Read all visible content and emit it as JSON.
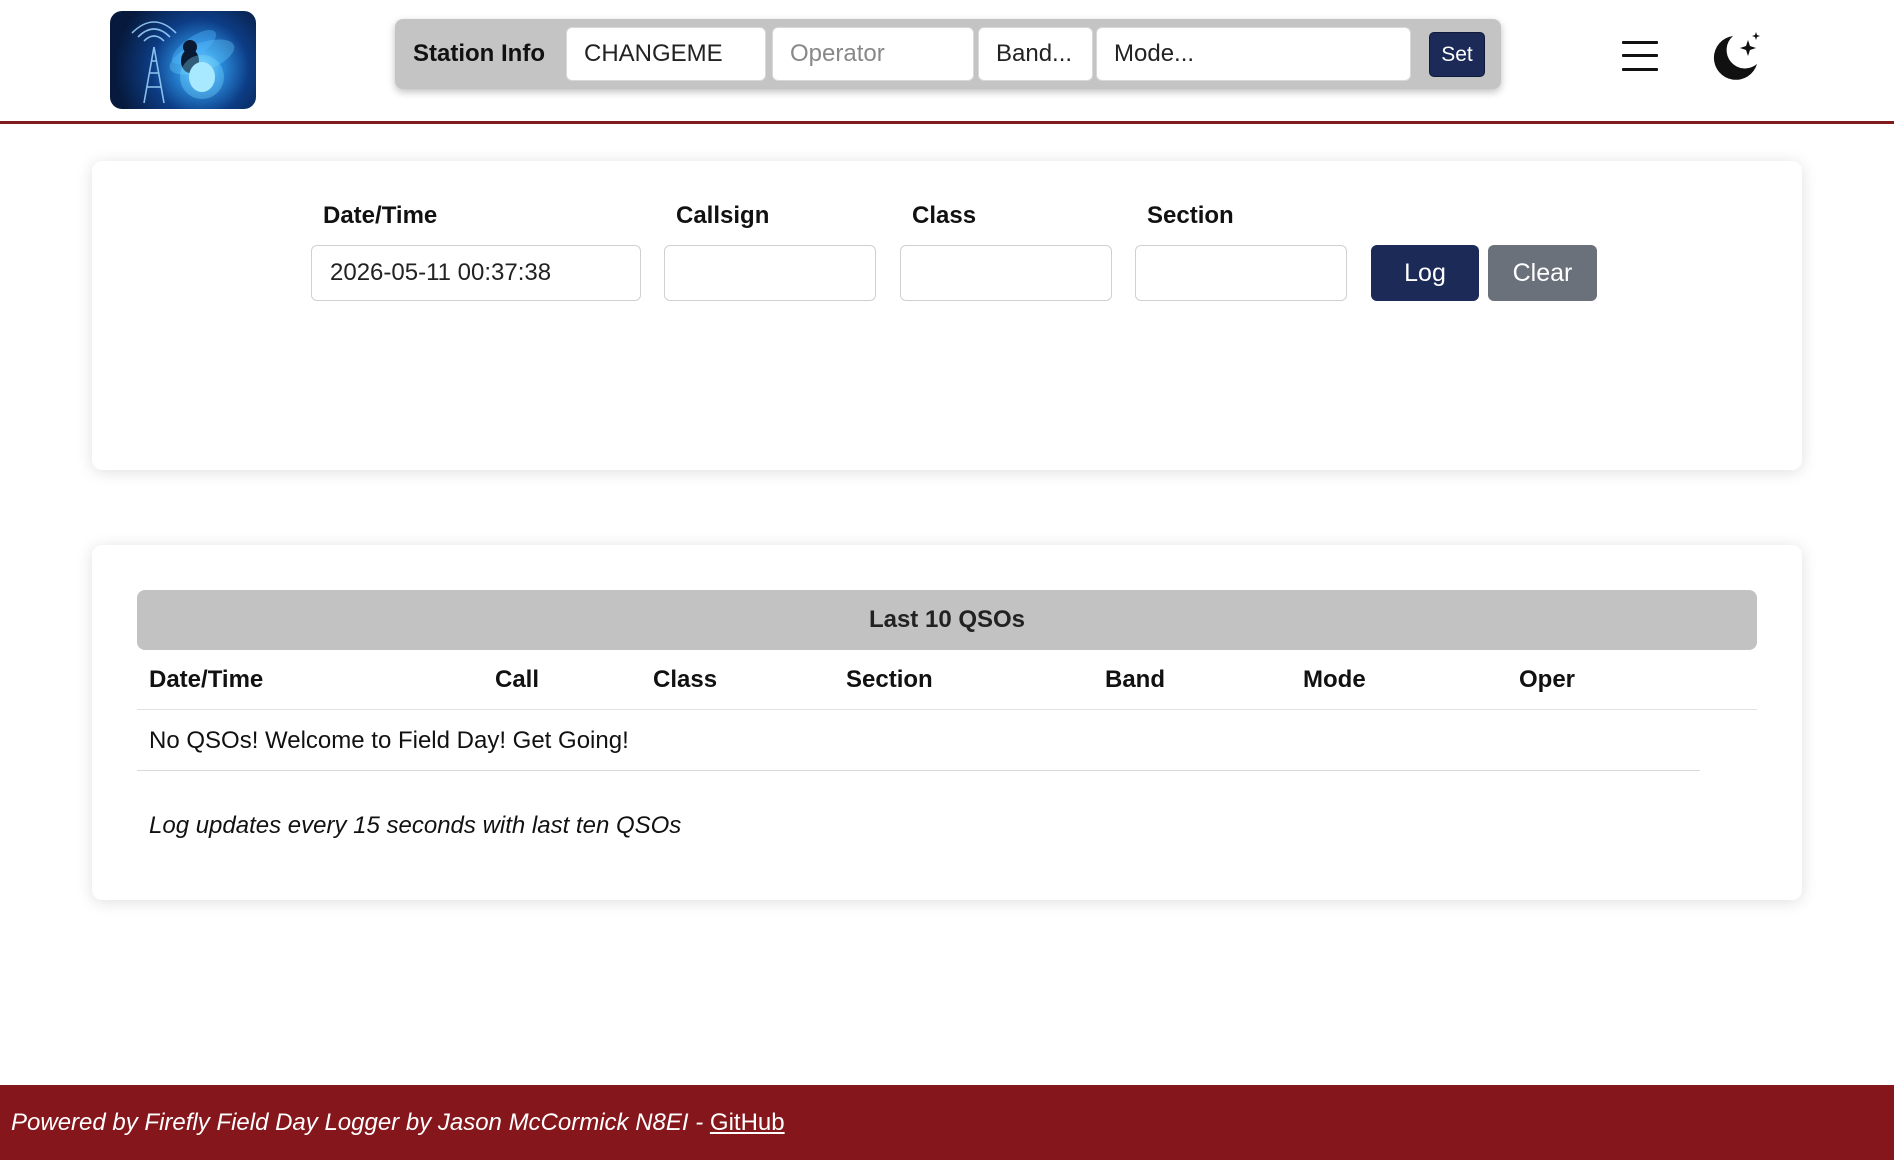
{
  "header": {
    "station_label": "Station Info",
    "callsign_value": "CHANGEME",
    "operator_placeholder": "Operator",
    "band_selected": "Band...",
    "mode_selected": "Mode...",
    "set_label": "Set",
    "menu_icon": "hamburger-menu-icon",
    "theme_icon": "moon-stars-icon"
  },
  "form": {
    "datetime_label": "Date/Time",
    "datetime_value": "2026-05-11 00:37:38",
    "callsign_label": "Callsign",
    "callsign_value": "",
    "class_label": "Class",
    "class_value": "",
    "section_label": "Section",
    "section_value": "",
    "log_label": "Log",
    "clear_label": "Clear"
  },
  "qsos": {
    "title": "Last 10 QSOs",
    "columns": [
      "Date/Time",
      "Call",
      "Class",
      "Section",
      "Band",
      "Mode",
      "Oper"
    ],
    "empty_message": "No QSOs! Welcome to Field Day! Get Going!",
    "note": "Log updates every 15 seconds with last ten QSOs"
  },
  "footer": {
    "text": "Powered by Firefly Field Day Logger by Jason McCormick N8EI - ",
    "link_label": "GitHub"
  },
  "colors": {
    "navy": "#1b2a57",
    "gray_button": "#6b717b",
    "maroon": "#85161b"
  }
}
